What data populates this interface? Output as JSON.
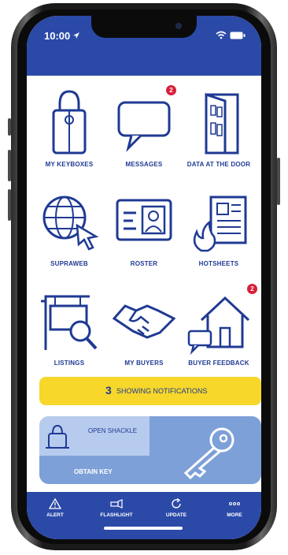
{
  "status": {
    "time": "10:00",
    "signal": "✈",
    "right": "⌁ ▬"
  },
  "tiles": [
    {
      "label": "MY KEYBOXES",
      "icon": "keybox-icon"
    },
    {
      "label": "MESSAGES",
      "icon": "chat-bubble-icon",
      "badge": "2"
    },
    {
      "label": "DATA AT THE DOOR",
      "icon": "open-door-icon"
    },
    {
      "label": "SUPRAWEB",
      "icon": "globe-cursor-icon"
    },
    {
      "label": "ROSTER",
      "icon": "id-card-icon"
    },
    {
      "label": "HOTSHEETS",
      "icon": "hot-document-icon"
    },
    {
      "label": "LISTINGS",
      "icon": "sign-search-icon"
    },
    {
      "label": "MY BUYERS",
      "icon": "handshake-icon"
    },
    {
      "label": "BUYER FEEDBACK",
      "icon": "house-chat-icon",
      "badge": "2"
    }
  ],
  "notifications": {
    "count": "3",
    "label": "SHOWING NOTIFICATIONS"
  },
  "key_panel": {
    "open_shackle": "OPEN SHACKLE",
    "obtain_key": "OBTAIN KEY"
  },
  "tabbar": [
    {
      "label": "ALERT",
      "icon": "warning-icon"
    },
    {
      "label": "FLASHLIGHT",
      "icon": "flashlight-icon"
    },
    {
      "label": "UPDATE",
      "icon": "update-icon"
    },
    {
      "label": "MORE",
      "icon": "more-dots-icon"
    }
  ],
  "colors": {
    "primary": "#2b4aa8",
    "icon_blue": "#1f3a93",
    "notification_yellow": "#f6d72a",
    "badge_red": "#d9203a",
    "key_panel": "#7ea0d8"
  }
}
